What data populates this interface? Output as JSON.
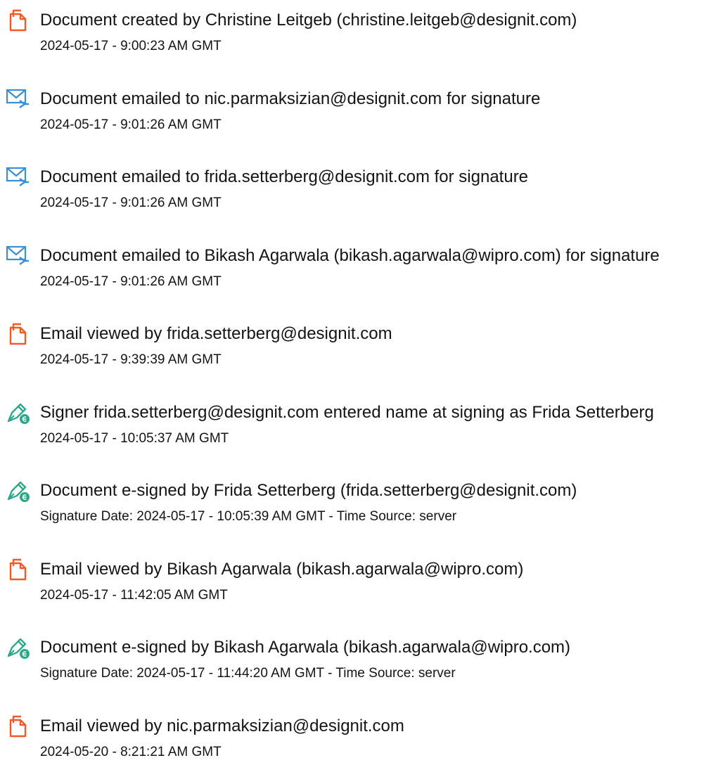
{
  "colors": {
    "created_icon": "#f05a28",
    "email_icon": "#3a8fd6",
    "sign_icon": "#2aa889"
  },
  "events": [
    {
      "icon": "document-icon",
      "title": "Document created by Christine Leitgeb (christine.leitgeb@designit.com)",
      "time": "2024-05-17 - 9:00:23 AM GMT"
    },
    {
      "icon": "email-sent-icon",
      "title": "Document emailed to nic.parmaksizian@designit.com for signature",
      "time": "2024-05-17 - 9:01:26 AM GMT"
    },
    {
      "icon": "email-sent-icon",
      "title": "Document emailed to frida.setterberg@designit.com for signature",
      "time": "2024-05-17 - 9:01:26 AM GMT"
    },
    {
      "icon": "email-sent-icon",
      "title": "Document emailed to Bikash Agarwala (bikash.agarwala@wipro.com) for signature",
      "time": "2024-05-17 - 9:01:26 AM GMT"
    },
    {
      "icon": "document-icon",
      "title": "Email viewed by frida.setterberg@designit.com",
      "time": "2024-05-17 - 9:39:39 AM GMT"
    },
    {
      "icon": "esign-pen-icon",
      "title": "Signer frida.setterberg@designit.com entered name at signing as Frida Setterberg",
      "time": "2024-05-17 - 10:05:37 AM GMT"
    },
    {
      "icon": "esign-pen-icon",
      "title": "Document e-signed by Frida Setterberg (frida.setterberg@designit.com)",
      "time": "Signature Date: 2024-05-17 - 10:05:39 AM GMT - Time Source: server"
    },
    {
      "icon": "document-icon",
      "title": "Email viewed by Bikash Agarwala (bikash.agarwala@wipro.com)",
      "time": "2024-05-17 - 11:42:05 AM GMT"
    },
    {
      "icon": "esign-pen-icon",
      "title": "Document e-signed by Bikash Agarwala (bikash.agarwala@wipro.com)",
      "time": "Signature Date: 2024-05-17 - 11:44:20 AM GMT - Time Source: server"
    },
    {
      "icon": "document-icon",
      "title": "Email viewed by nic.parmaksizian@designit.com",
      "time": "2024-05-20 - 8:21:21 AM GMT"
    }
  ]
}
